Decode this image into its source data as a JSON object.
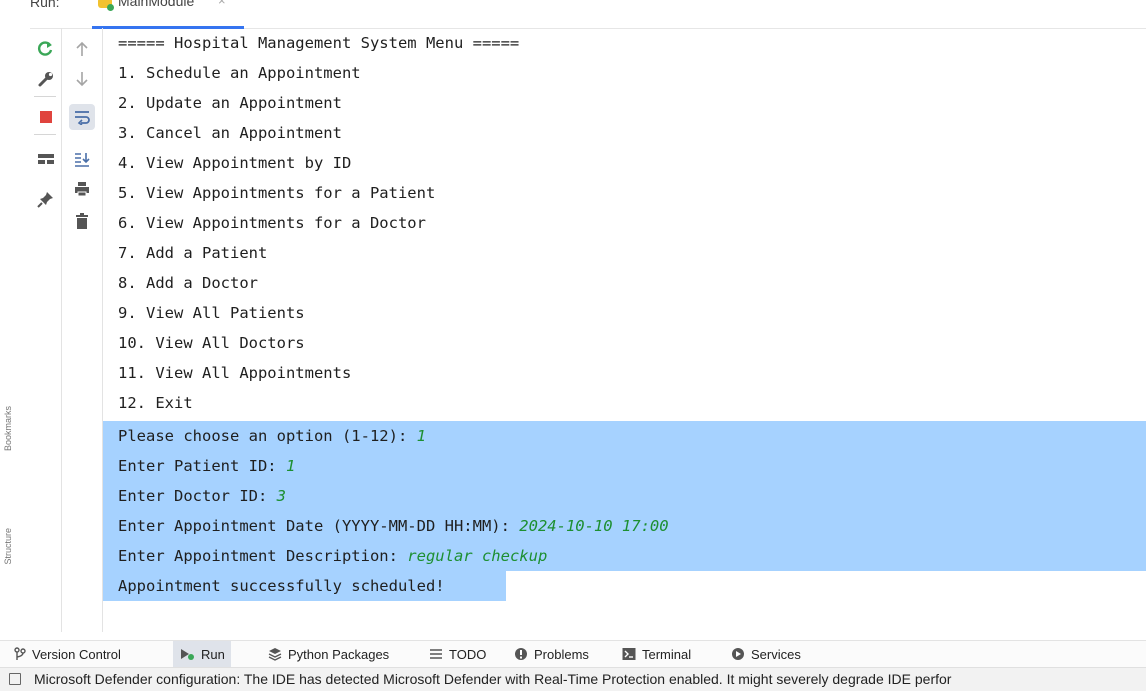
{
  "header": {
    "run_label": "Run:",
    "tab_title": "MainModule",
    "tab_close": "×"
  },
  "left_strip": {
    "bookmarks": "Bookmarks",
    "structure": "Structure"
  },
  "console": {
    "lines": [
      {
        "text": "===== Hospital Management System Menu =====",
        "input": "",
        "selected": false
      },
      {
        "text": "1. Schedule an Appointment",
        "input": "",
        "selected": false
      },
      {
        "text": "2. Update an Appointment",
        "input": "",
        "selected": false
      },
      {
        "text": "3. Cancel an Appointment",
        "input": "",
        "selected": false
      },
      {
        "text": "4. View Appointment by ID",
        "input": "",
        "selected": false
      },
      {
        "text": "5. View Appointments for a Patient",
        "input": "",
        "selected": false
      },
      {
        "text": "6. View Appointments for a Doctor",
        "input": "",
        "selected": false
      },
      {
        "text": "7. Add a Patient",
        "input": "",
        "selected": false
      },
      {
        "text": "8. Add a Doctor",
        "input": "",
        "selected": false
      },
      {
        "text": "9. View All Patients",
        "input": "",
        "selected": false
      },
      {
        "text": "10. View All Doctors",
        "input": "",
        "selected": false
      },
      {
        "text": "11. View All Appointments",
        "input": "",
        "selected": false
      },
      {
        "text": "12. Exit",
        "input": "",
        "selected": false
      },
      {
        "text": "Please choose an option (1-12): ",
        "input": "1",
        "selected": true
      },
      {
        "text": "Enter Patient ID: ",
        "input": "1",
        "selected": true
      },
      {
        "text": "Enter Doctor ID: ",
        "input": "3",
        "selected": true
      },
      {
        "text": "Enter Appointment Date (YYYY-MM-DD HH:MM): ",
        "input": "2024-10-10 17:00",
        "selected": true
      },
      {
        "text": "Enter Appointment Description: ",
        "input": "regular checkup",
        "selected": true
      },
      {
        "text": "Appointment successfully scheduled!",
        "input": "",
        "selected": true
      }
    ],
    "input_color": "#1d8f31",
    "selection_color": "#a6d2ff"
  },
  "bottom_bar": {
    "version_control": "Version Control",
    "run": "Run",
    "python_packages": "Python Packages",
    "todo": "TODO",
    "problems": "Problems",
    "terminal": "Terminal",
    "services": "Services"
  },
  "status_bar": {
    "message": "Microsoft Defender configuration: The IDE has detected Microsoft Defender with Real-Time Protection enabled. It might severely degrade IDE perfor"
  }
}
